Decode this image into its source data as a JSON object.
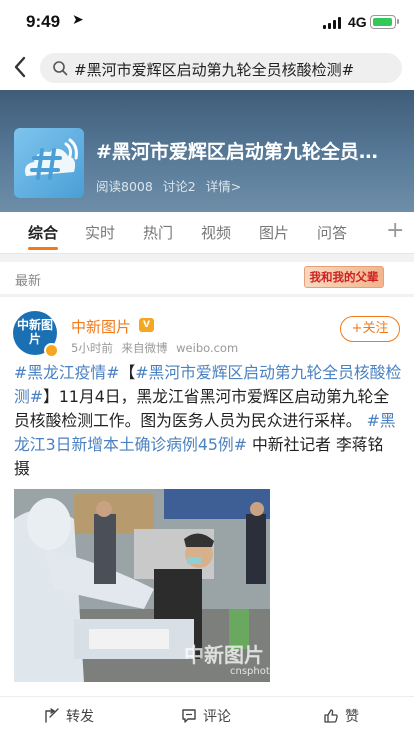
{
  "status_bar": {
    "time": "9:49",
    "network": "4G",
    "location_icon": "location-arrow-icon",
    "battery_color": "#34c759"
  },
  "search": {
    "query": "#黑河市爱辉区启动第九轮全员核酸检测#"
  },
  "topic": {
    "title": "#黑河市爱辉区启动第九轮全员…",
    "reads": "阅读8008",
    "discussions": "讨论2",
    "details": "详情>"
  },
  "tabs": [
    "综合",
    "实时",
    "热门",
    "视频",
    "图片",
    "问答"
  ],
  "feed": {
    "label": "最新",
    "badge": "我和我的父辈"
  },
  "post": {
    "author": "中新图片",
    "avatar_text": "中新图片",
    "time": "5小时前",
    "source": "来自微博",
    "domain": "weibo.com",
    "follow_label": "+关注",
    "text_parts": [
      {
        "text": "#黑龙江疫情#",
        "tag": true
      },
      {
        "text": "【",
        "tag": false
      },
      {
        "text": "#黑河市爱辉区启动第九轮全员核酸检测#",
        "tag": true
      },
      {
        "text": "】11月4日，黑龙江省黑河市爱辉区启动第九轮全员核酸检测工作。图为医务人员为民众进行采样。 ",
        "tag": false
      },
      {
        "text": "#黑龙江3日新增本土确诊病例45例#",
        "tag": true
      },
      {
        "text": " 中新社记者 李蒋铭 摄",
        "tag": false
      }
    ],
    "watermark": "中新图片",
    "watermark_sub": "cnsphoto"
  },
  "actions": {
    "repost": "转发",
    "comment": "评论",
    "like": "赞"
  },
  "colors": {
    "accent": "#f27a1a",
    "tag": "#4a81c2",
    "banner": "#4f6f8d"
  }
}
